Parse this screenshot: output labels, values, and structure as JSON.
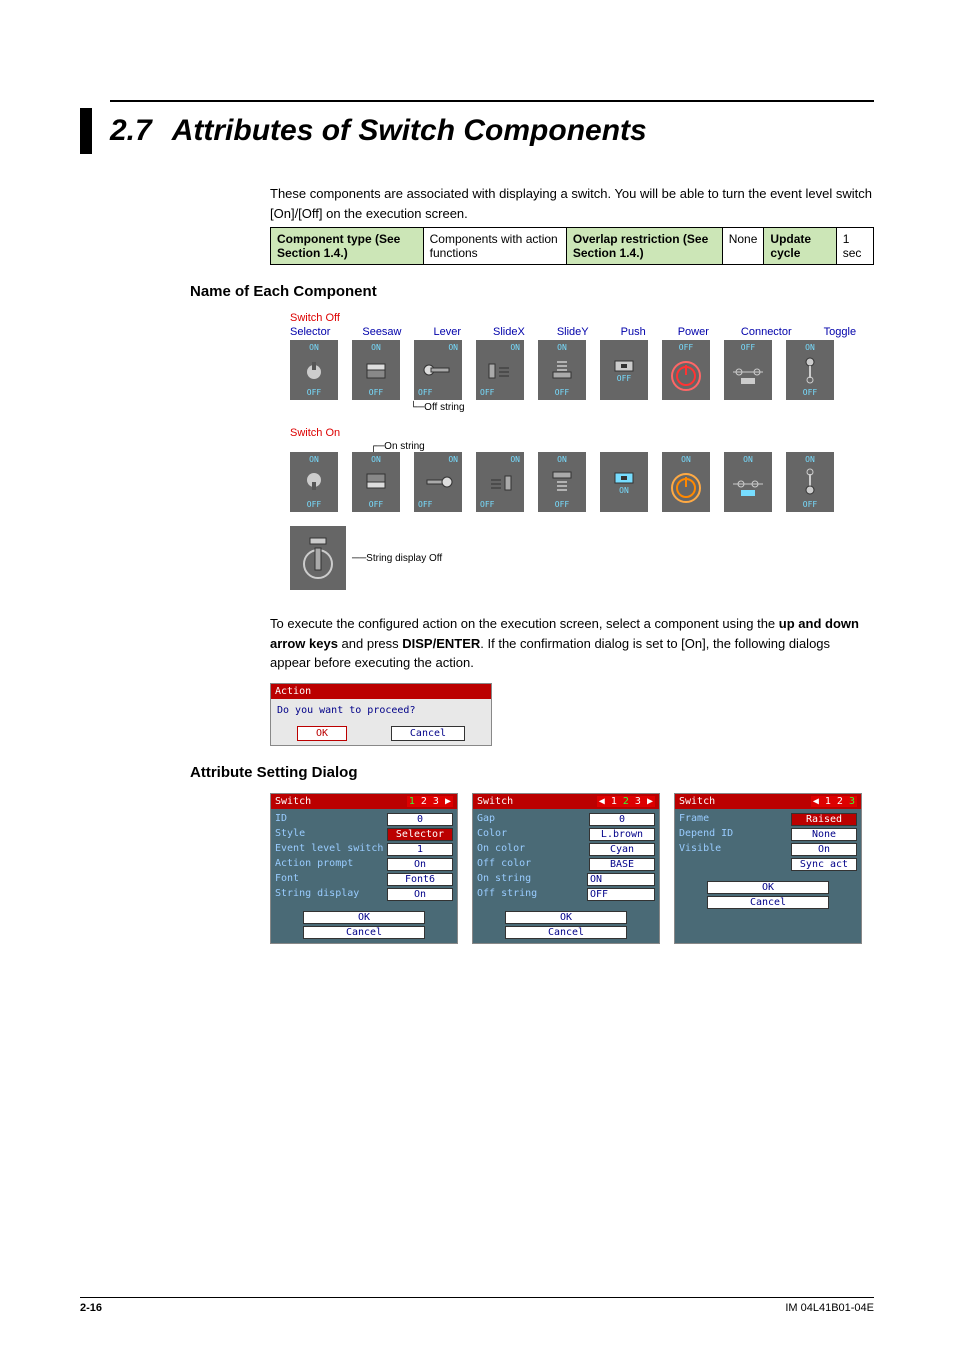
{
  "section": {
    "num": "2.7",
    "title": "Attributes of Switch Components"
  },
  "intro": "These components are associated with displaying a switch. You will be able to turn the event level switch [On]/[Off] on the execution screen.",
  "table": {
    "h1": "Component type (See Section 1.4.)",
    "v1": "Components with action functions",
    "h2": "Overlap restriction (See Section 1.4.)",
    "v2": "None",
    "h3": "Update cycle",
    "v3": "1 sec"
  },
  "sub1": "Name of Each Component",
  "switch_row1_heading": "Switch Off",
  "switch_row2_heading": "Switch On",
  "blue_labels": [
    "Selector",
    "Seesaw",
    "Lever",
    "SlideX",
    "SlideY",
    "Push",
    "Power",
    "Connector",
    "Toggle"
  ],
  "switch_annotations": {
    "off_string": "Off string",
    "on_string": "On string",
    "string_display_off": "String display Off"
  },
  "sw_label_on": "ON",
  "sw_label_off": "OFF",
  "body2a": "To execute the configured action on the execution screen, select a component using the ",
  "body2b": "up and down arrow keys",
  "body2c": " and press ",
  "body2d": "DISP/ENTER",
  "body2e": ". If the confirmation dialog is set to [On], the following dialogs appear before executing the action.",
  "action_dialog": {
    "title": "Action",
    "msg": "Do you want to proceed?",
    "ok": "OK",
    "cancel": "Cancel"
  },
  "sub2": "Attribute Setting Dialog",
  "dlg1": {
    "title": "Switch",
    "page_pre": "",
    "page_sel": "1",
    "page_post": " 2 3 ▶",
    "rows": [
      {
        "lab": "ID",
        "val": "0",
        "sel": false
      },
      {
        "lab": "Style",
        "val": "Selector",
        "sel": true
      },
      {
        "lab": "Event level switch",
        "val": "1",
        "sel": false
      },
      {
        "lab": "Action prompt",
        "val": "On",
        "sel": false
      },
      {
        "lab": "Font",
        "val": "Font6",
        "sel": false
      },
      {
        "lab": "String display",
        "val": "On",
        "sel": false
      }
    ],
    "ok": "OK",
    "cancel": "Cancel"
  },
  "dlg2": {
    "title": "Switch",
    "page_pre": "◀ 1 ",
    "page_sel": "2",
    "page_post": " 3 ▶",
    "rows": [
      {
        "lab": "Gap",
        "val": "0",
        "sel": false
      },
      {
        "lab": "Color",
        "val": "L.brown",
        "sel": false
      },
      {
        "lab": "On color",
        "val": "Cyan",
        "sel": false
      },
      {
        "lab": "Off color",
        "val": "BASE",
        "sel": false
      },
      {
        "lab": "On string",
        "val": "ON",
        "sel": false,
        "inp": true
      },
      {
        "lab": "Off string",
        "val": "OFF",
        "sel": false,
        "inp": true
      }
    ],
    "ok": "OK",
    "cancel": "Cancel"
  },
  "dlg3": {
    "title": "Switch",
    "page_pre": "◀ 1 2 ",
    "page_sel": "3",
    "page_post": "",
    "rows": [
      {
        "lab": "Frame",
        "val": "Raised",
        "sel": true
      },
      {
        "lab": "Depend ID",
        "val": "None",
        "sel": false
      },
      {
        "lab": "Visible",
        "val": "On",
        "sel": false
      },
      {
        "lab": "",
        "val": "Sync act",
        "sel": false
      }
    ],
    "ok": "OK",
    "cancel": "Cancel"
  },
  "footer": {
    "pnum": "2-16",
    "doc": "IM 04L41B01-04E"
  }
}
